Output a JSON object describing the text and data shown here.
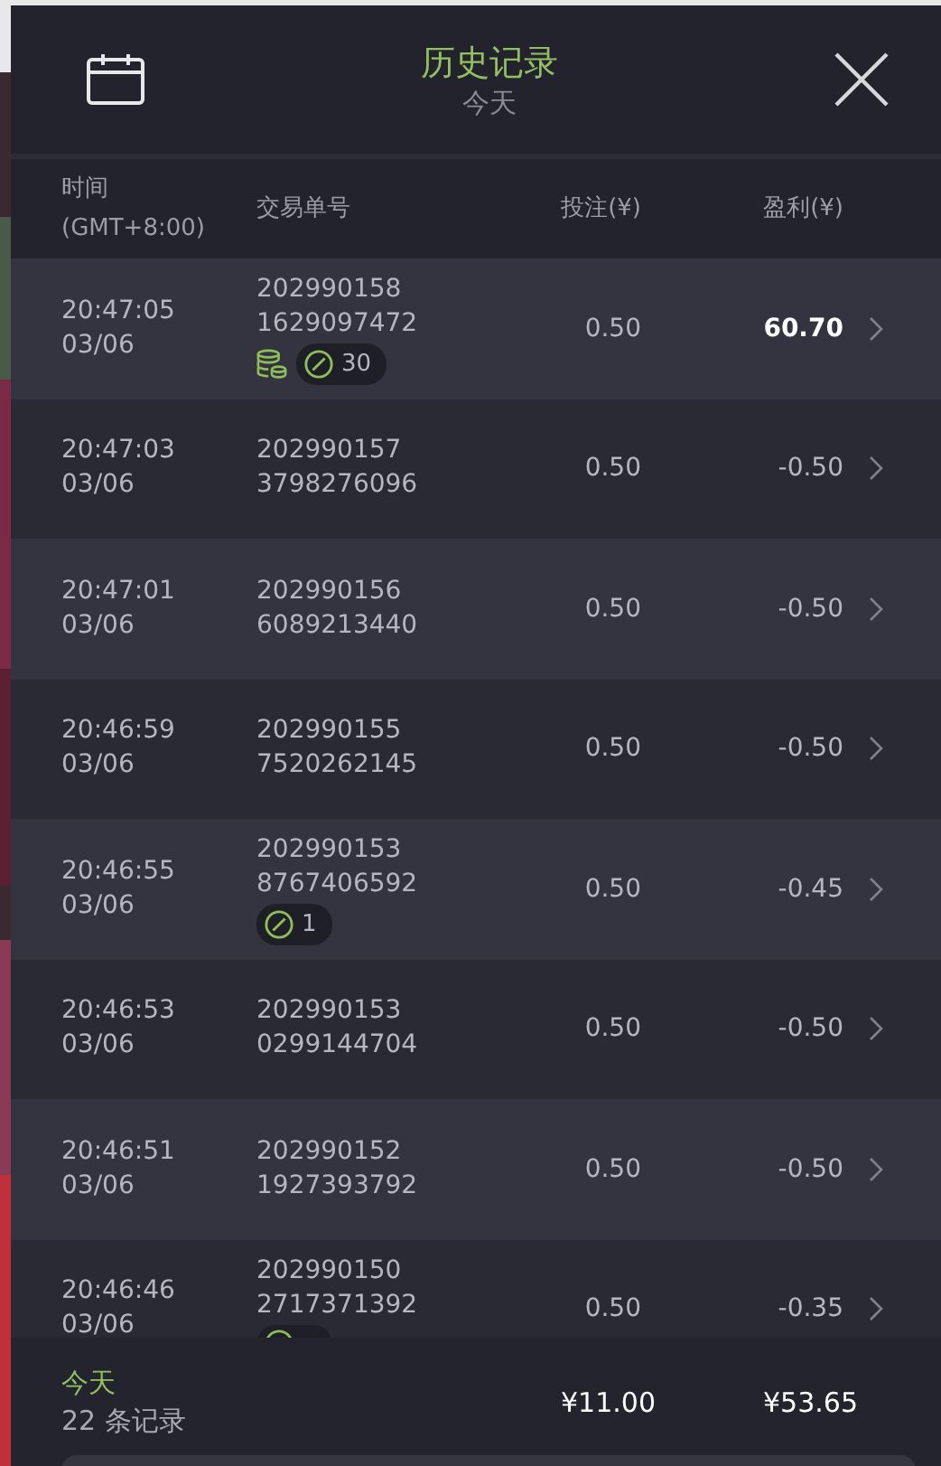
{
  "header": {
    "title": "历史记录",
    "subtitle": "今天"
  },
  "columns": [
    "时间\n(GMT+8:00)",
    "交易单号",
    "投注(¥)",
    "盈利(¥)"
  ],
  "rows": [
    {
      "time": "20:47:05",
      "date": "03/06",
      "id_line_1": "202990158",
      "id_line_2": "1629097472",
      "bet": "0.50",
      "profit": "60.70",
      "win": true,
      "tags": [
        {
          "kind": "coins"
        },
        {
          "kind": "badge",
          "count": "30"
        }
      ]
    },
    {
      "time": "20:47:03",
      "date": "03/06",
      "id_line_1": "202990157",
      "id_line_2": "3798276096",
      "bet": "0.50",
      "profit": "-0.50",
      "win": false,
      "tags": []
    },
    {
      "time": "20:47:01",
      "date": "03/06",
      "id_line_1": "202990156",
      "id_line_2": "6089213440",
      "bet": "0.50",
      "profit": "-0.50",
      "win": false,
      "tags": []
    },
    {
      "time": "20:46:59",
      "date": "03/06",
      "id_line_1": "202990155",
      "id_line_2": "7520262145",
      "bet": "0.50",
      "profit": "-0.50",
      "win": false,
      "tags": []
    },
    {
      "time": "20:46:55",
      "date": "03/06",
      "id_line_1": "202990153",
      "id_line_2": "8767406592",
      "bet": "0.50",
      "profit": "-0.45",
      "win": false,
      "tags": [
        {
          "kind": "badge",
          "count": "1"
        }
      ]
    },
    {
      "time": "20:46:53",
      "date": "03/06",
      "id_line_1": "202990153",
      "id_line_2": "0299144704",
      "bet": "0.50",
      "profit": "-0.50",
      "win": false,
      "tags": []
    },
    {
      "time": "20:46:51",
      "date": "03/06",
      "id_line_1": "202990152",
      "id_line_2": "1927393792",
      "bet": "0.50",
      "profit": "-0.50",
      "win": false,
      "tags": []
    },
    {
      "time": "20:46:46",
      "date": "03/06",
      "id_line_1": "202990150",
      "id_line_2": "2717371392",
      "bet": "0.50",
      "profit": "-0.35",
      "win": false,
      "tags": [
        {
          "kind": "badge"
        }
      ]
    }
  ],
  "footer": {
    "period": "今天",
    "count": "22 条记录",
    "total_bet": "¥11.00",
    "total_profit": "¥53.65"
  }
}
